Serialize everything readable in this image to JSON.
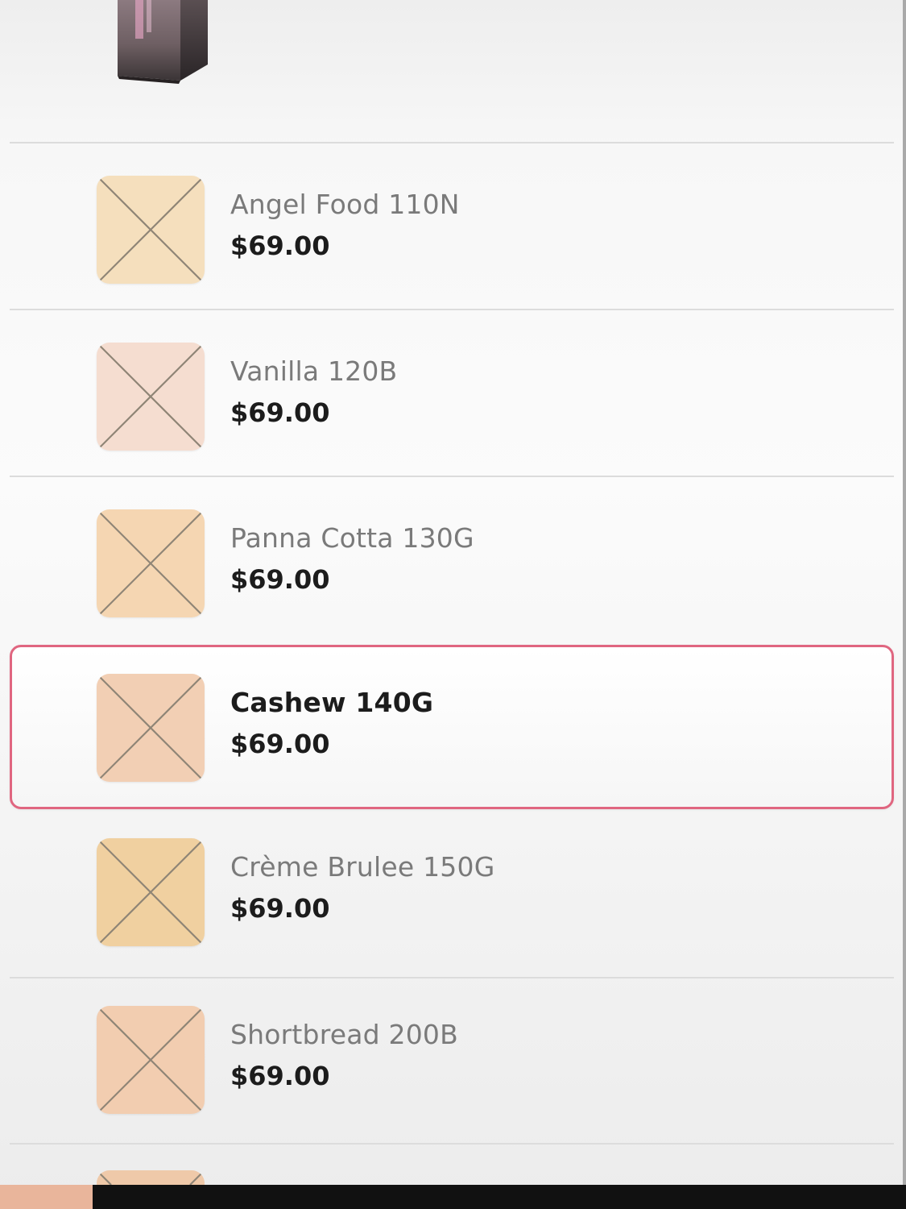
{
  "shades": [
    {
      "name": "Angel Food 110N",
      "price": "$69.00",
      "color": "#f5dfbd",
      "selected": false
    },
    {
      "name": "Vanilla 120B",
      "price": "$69.00",
      "color": "#f5ddd0",
      "selected": false
    },
    {
      "name": "Panna Cotta 130G",
      "price": "$69.00",
      "color": "#f5d6b2",
      "selected": false
    },
    {
      "name": "Cashew 140G",
      "price": "$69.00",
      "color": "#f2cfb4",
      "selected": true
    },
    {
      "name": "Crème Brulee 150G",
      "price": "$69.00",
      "color": "#f0d0a0",
      "selected": false
    },
    {
      "name": "Shortbread 200B",
      "price": "$69.00",
      "color": "#f2cdb0",
      "selected": false
    }
  ],
  "colors": {
    "selected_border": "#e06680",
    "divider": "#dcdcdc",
    "price_text": "#1c1c1c",
    "name_text": "#7a7a7a",
    "swatch_cross": "#8f8576",
    "bottom_bar": "#111111",
    "bottom_accent": "#e9b59b"
  },
  "icons": {
    "product_image": "foundation-bottle-box-image",
    "swatch_placeholder": "broken-image-x-icon"
  }
}
